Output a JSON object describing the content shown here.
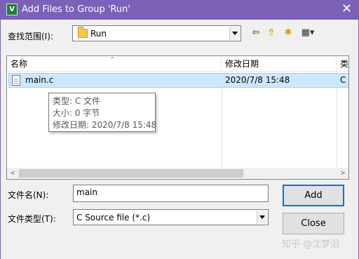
{
  "window": {
    "title": "Add Files to Group 'Run'",
    "icon_letter": "V",
    "close_glyph": "✕"
  },
  "lookin": {
    "label": "查找范围(I):",
    "value": "Run"
  },
  "toolbar": {
    "back_glyph": "⇦",
    "up_glyph": "⇮",
    "newfolder_glyph": "✱",
    "view_glyph": "▦▾"
  },
  "file_list": {
    "columns": [
      "名称",
      "修改日期",
      "类"
    ],
    "sort_glyph": "^",
    "rows": [
      {
        "name": "main.c",
        "modified": "2020/7/8 15:48",
        "type": "C"
      }
    ],
    "scroll_left_glyph": "<",
    "scroll_right_glyph": ">"
  },
  "tooltip": {
    "type_line": "类型: C 文件",
    "size_line": "大小: 0 字节",
    "date_line": "修改日期: 2020/7/8 15:48"
  },
  "filename": {
    "label": "文件名(N):",
    "value": "main"
  },
  "filetype": {
    "label": "文件类型(T):",
    "value": "C Source file (*.c)"
  },
  "buttons": {
    "add": "Add",
    "close": "Close"
  },
  "watermark": "知乎 @沈梦泪",
  "colors": {
    "titlebar": "#7b61b7",
    "selection": "#cce8ff",
    "default_button_border": "#0078d7"
  }
}
